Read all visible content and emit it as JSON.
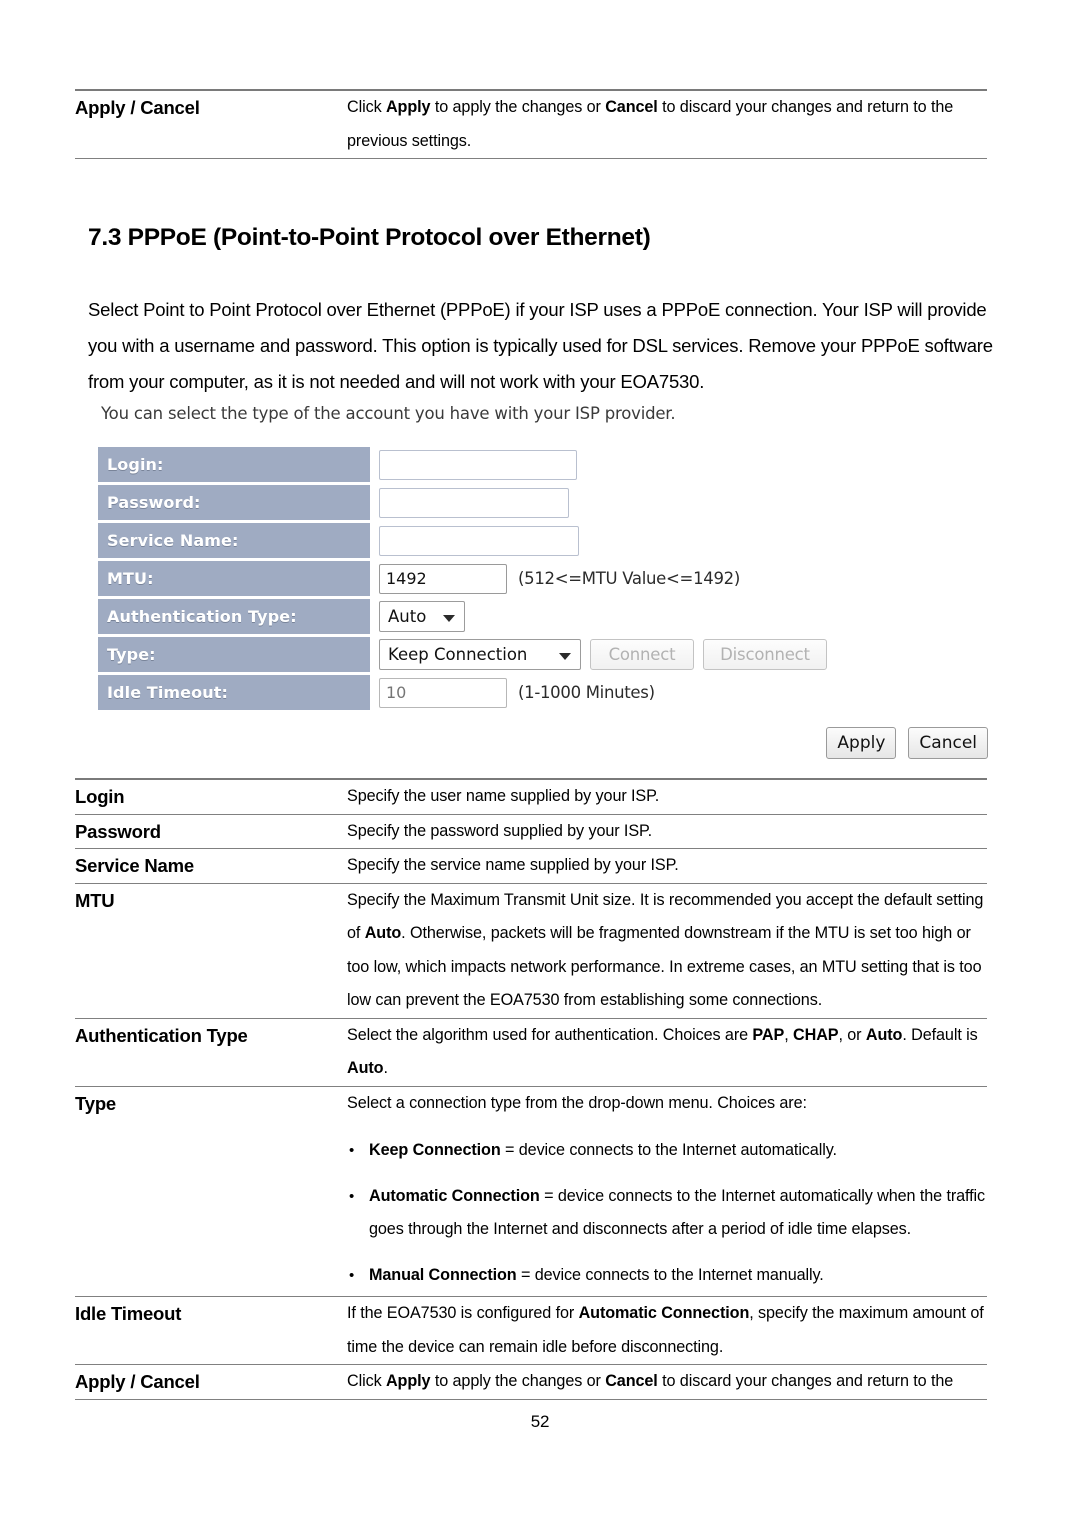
{
  "document": {
    "page_number": "52",
    "section": {
      "number": "7.3",
      "title": "PPPoE (Point-to-Point Protocol over Ethernet)",
      "heading_full": "7.3 PPPoE (Point-to-Point Protocol over Ethernet)",
      "intro": "Select Point to Point Protocol over Ethernet (PPPoE) if  your ISP uses a PPPoE connection. Your ISP will provide you with a username and password. This option is typically used for DSL services. Remove your PPPoE software from your computer, as it is not needed and will not work with your EOA7530."
    }
  },
  "top_table": {
    "rows": [
      {
        "term": "Apply / Cancel",
        "def_parts": [
          {
            "t": "Click ",
            "b": false
          },
          {
            "t": "Apply",
            "b": true
          },
          {
            "t": " to apply the changes or ",
            "b": false
          },
          {
            "t": "Cancel",
            "b": true
          },
          {
            "t": " to discard your changes and return to the previous settings.",
            "b": false
          }
        ]
      }
    ]
  },
  "screenshot": {
    "caption": "You can select the type of the account you have with your ISP provider.",
    "label_bg": "#9fabc2",
    "fields": [
      {
        "label": "Login:",
        "value": "",
        "placeholder": ""
      },
      {
        "label": "Password:",
        "value": "",
        "placeholder": ""
      },
      {
        "label": "Service Name:",
        "value": "",
        "placeholder": ""
      },
      {
        "label": "MTU:",
        "value": "1492",
        "hint": "(512<=MTU Value<=1492)"
      },
      {
        "label": "Authentication Type:",
        "selected": "Auto"
      },
      {
        "label": "Type:",
        "selected": "Keep Connection",
        "buttons": [
          "Connect",
          "Disconnect"
        ]
      },
      {
        "label": "Idle Timeout:",
        "placeholder": "10",
        "hint": "(1-1000 Minutes)"
      }
    ],
    "actions": {
      "apply": "Apply",
      "cancel": "Cancel"
    }
  },
  "bottom_table": {
    "rows": [
      {
        "term": "Login",
        "def_parts": [
          {
            "t": "Specify the user name supplied by your ISP.",
            "b": false
          }
        ]
      },
      {
        "term": "Password",
        "def_parts": [
          {
            "t": "Specify the password supplied by your ISP.",
            "b": false
          }
        ]
      },
      {
        "term": "Service Name",
        "def_parts": [
          {
            "t": "Specify the service name supplied by your ISP.",
            "b": false
          }
        ]
      },
      {
        "term": "MTU",
        "def_parts": [
          {
            "t": "Specify the Maximum Transmit Unit size. It is recommended you accept the default setting of ",
            "b": false
          },
          {
            "t": "Auto",
            "b": true
          },
          {
            "t": ". Otherwise, packets will be fragmented downstream if the MTU is set too high or too low, which impacts network performance. In extreme cases, an MTU setting that is too low can prevent the EOA7530 from establishing some connections.",
            "b": false
          }
        ]
      },
      {
        "term": "Authentication Type",
        "def_parts": [
          {
            "t": "Select the algorithm used for authentication. Choices are ",
            "b": false
          },
          {
            "t": "PAP",
            "b": true
          },
          {
            "t": ", ",
            "b": false
          },
          {
            "t": "CHAP",
            "b": true
          },
          {
            "t": ", or ",
            "b": false
          },
          {
            "t": "Auto",
            "b": true
          },
          {
            "t": ". Default is ",
            "b": false
          },
          {
            "t": "Auto",
            "b": true
          },
          {
            "t": ".",
            "b": false
          }
        ]
      },
      {
        "term": "Type",
        "def_parts": [
          {
            "t": "Select a connection type from the drop-down menu. Choices are:",
            "b": false
          }
        ],
        "bullets": [
          [
            {
              "t": "Keep Connection",
              "b": true
            },
            {
              "t": " = device connects to the Internet automatically.",
              "b": false
            }
          ],
          [
            {
              "t": "Automatic Connection",
              "b": true
            },
            {
              "t": " = device connects to the Internet automatically when the traffic goes through the Internet and disconnects after a period of idle time elapses.",
              "b": false
            }
          ],
          [
            {
              "t": "Manual Connection",
              "b": true
            },
            {
              "t": " = device connects to the Internet manually.",
              "b": false
            }
          ]
        ]
      },
      {
        "term": "Idle Timeout",
        "def_parts": [
          {
            "t": "If the EOA7530 is configured for ",
            "b": false
          },
          {
            "t": "Automatic Connection",
            "b": true
          },
          {
            "t": ", specify the maximum amount of time the device can remain idle before disconnecting.",
            "b": false
          }
        ]
      },
      {
        "term": "Apply / Cancel",
        "def_parts": [
          {
            "t": "Click ",
            "b": false
          },
          {
            "t": "Apply",
            "b": true
          },
          {
            "t": " to apply the changes or ",
            "b": false
          },
          {
            "t": "Cancel",
            "b": true
          },
          {
            "t": " to discard your changes and return to the",
            "b": false
          }
        ]
      }
    ]
  }
}
